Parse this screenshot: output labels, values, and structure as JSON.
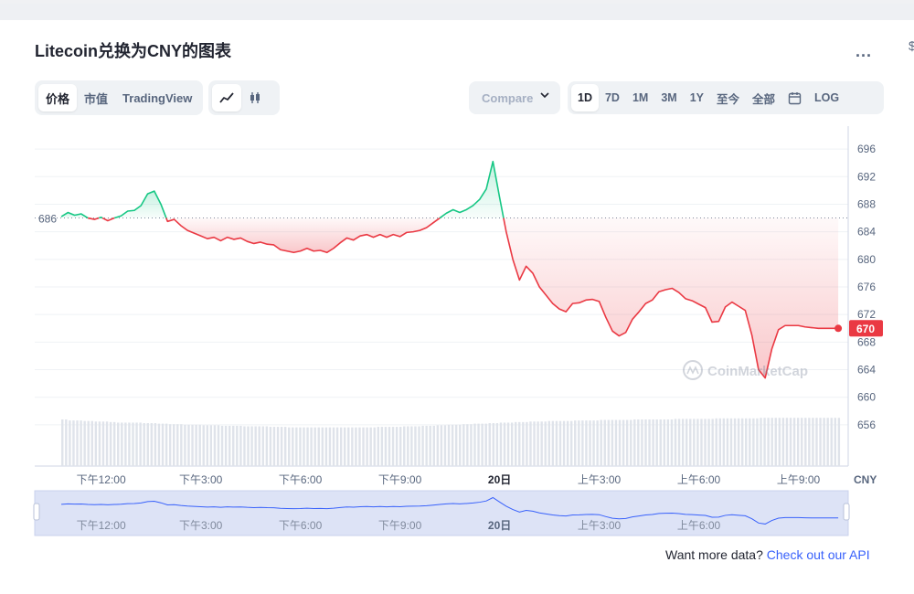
{
  "title": "Litecoin兑换为CNY的图表",
  "more_label": "...",
  "edge_mark": "$",
  "view_tabs": [
    "价格",
    "市值",
    "TradingView"
  ],
  "chart_type_icons": [
    "line-chart-icon",
    "candlestick-icon"
  ],
  "compare_label": "Compare  ",
  "range_tabs": [
    "1D",
    "7D",
    "1M",
    "3M",
    "1Y",
    "至今",
    "全部"
  ],
  "calendar_icon": "calendar-icon",
  "log_label": "LOG",
  "colors": {
    "up": "#16c784",
    "down": "#ea3943",
    "accent": "#3861fb"
  },
  "footer": {
    "text": "Want more data?",
    "link": "Check out our API"
  },
  "chart_data": {
    "type": "line",
    "currency": "CNY",
    "reference_price": 686,
    "reference_label": "686",
    "current_price": 670,
    "current_label": "670",
    "watermark": "CoinMarketCap",
    "y_ticks": [
      "696",
      "692",
      "688",
      "684",
      "680",
      "676",
      "672",
      "668",
      "664",
      "660",
      "656"
    ],
    "y_tick_values": [
      696,
      692,
      688,
      684,
      680,
      676,
      672,
      668,
      664,
      660,
      656
    ],
    "ylim": [
      654,
      698
    ],
    "x_ticks": [
      "下午12:00",
      "下午3:00",
      "下午6:00",
      "下午9:00",
      "20日",
      "上午3:00",
      "上午6:00",
      "上午9:00"
    ],
    "x_tick_hours": [
      12,
      15,
      18,
      21,
      24,
      27,
      30,
      33
    ],
    "navigator_ticks": [
      "下午12:00",
      "下午3:00",
      "下午6:00",
      "下午9:00",
      "20日",
      "上午3:00",
      "上午6:00"
    ],
    "xlim_hours": [
      10,
      34.5
    ],
    "series": [
      {
        "x": [
          10.8,
          11.0,
          11.2,
          11.4,
          11.6,
          11.8,
          12.0,
          12.2,
          12.4,
          12.6,
          12.8,
          13.0,
          13.2,
          13.4,
          13.6,
          13.8,
          14.0,
          14.2,
          14.4,
          14.6,
          14.8,
          15.0,
          15.2,
          15.4,
          15.6,
          15.8,
          16.0,
          16.2,
          16.4,
          16.6,
          16.8,
          17.0,
          17.2,
          17.4,
          17.6,
          17.8,
          18.0,
          18.2,
          18.4,
          18.6,
          18.8,
          19.0,
          19.2,
          19.4,
          19.6,
          19.8,
          20.0,
          20.2,
          20.4,
          20.6,
          20.8,
          21.0,
          21.2,
          21.4,
          21.6,
          21.8,
          22.0,
          22.2,
          22.4,
          22.6,
          22.8,
          23.0,
          23.2,
          23.4,
          23.6,
          23.8,
          24.0,
          24.2,
          24.4,
          24.6,
          24.8,
          25.0,
          25.2,
          25.4,
          25.6,
          25.8,
          26.0,
          26.2,
          26.4,
          26.6,
          26.8,
          27.0,
          27.2,
          27.4,
          27.6,
          27.8,
          28.0,
          28.2,
          28.4,
          28.6,
          28.8,
          29.0,
          29.2,
          29.4,
          29.6,
          29.8,
          30.0,
          30.2,
          30.4,
          30.6,
          30.8,
          31.0,
          31.2,
          31.4,
          31.6,
          31.8,
          32.0,
          32.2,
          32.4,
          32.6,
          32.8,
          33.0,
          33.2,
          33.4,
          33.6,
          33.8,
          34.0,
          34.1,
          34.2
        ],
        "y": [
          686.2,
          686.8,
          686.4,
          686.6,
          686.0,
          685.8,
          686.1,
          685.6,
          686.0,
          686.3,
          687.0,
          687.1,
          687.8,
          689.5,
          689.9,
          688.0,
          685.5,
          685.8,
          684.9,
          684.2,
          683.8,
          683.4,
          683.0,
          683.2,
          682.7,
          683.2,
          682.9,
          683.1,
          682.6,
          682.3,
          682.5,
          682.2,
          682.1,
          681.4,
          681.2,
          681.0,
          681.2,
          681.6,
          681.2,
          681.3,
          681.0,
          681.6,
          682.4,
          683.1,
          682.8,
          683.4,
          683.6,
          683.2,
          683.6,
          683.2,
          683.6,
          683.3,
          683.9,
          684.0,
          684.2,
          684.6,
          685.3,
          686.0,
          686.7,
          687.2,
          686.8,
          687.2,
          687.8,
          688.7,
          690.2,
          694.2,
          689.0,
          684.0,
          680.0,
          677.0,
          679.0,
          678.0,
          676.0,
          674.8,
          673.6,
          672.8,
          672.4,
          673.6,
          673.7,
          674.1,
          674.2,
          673.9,
          671.6,
          669.6,
          668.9,
          669.4,
          671.3,
          672.4,
          673.6,
          674.1,
          675.3,
          675.6,
          675.8,
          675.2,
          674.3,
          674.0,
          673.5,
          673.0,
          670.9,
          671.0,
          673.1,
          673.8,
          673.2,
          672.6,
          669.0,
          664.0,
          662.8,
          667.0,
          669.8,
          670.4,
          670.4,
          670.4,
          670.2,
          670.1,
          670.0,
          670.0,
          670.0,
          670.0,
          670.0
        ],
        "volume_level": [
          0.88,
          0.86,
          0.86,
          0.85,
          0.85,
          0.84,
          0.84,
          0.83,
          0.82,
          0.82,
          0.82,
          0.82,
          0.81,
          0.81,
          0.8,
          0.8,
          0.79,
          0.79,
          0.78,
          0.78,
          0.78,
          0.77,
          0.77,
          0.77,
          0.76,
          0.76,
          0.76,
          0.75,
          0.75,
          0.75,
          0.75,
          0.74,
          0.74,
          0.74,
          0.73,
          0.73,
          0.73,
          0.73,
          0.73,
          0.73,
          0.73,
          0.73,
          0.73,
          0.73,
          0.73,
          0.73,
          0.73,
          0.74,
          0.74,
          0.74,
          0.74,
          0.75,
          0.75,
          0.75,
          0.76,
          0.76,
          0.77,
          0.77,
          0.78,
          0.78,
          0.79,
          0.79,
          0.8,
          0.8,
          0.81,
          0.81,
          0.82,
          0.82,
          0.83,
          0.83,
          0.84,
          0.84,
          0.84,
          0.85,
          0.85,
          0.85,
          0.85,
          0.86,
          0.86,
          0.86,
          0.86,
          0.87,
          0.87,
          0.87,
          0.87,
          0.87,
          0.88,
          0.88,
          0.88,
          0.88,
          0.88,
          0.88,
          0.89,
          0.89,
          0.89,
          0.89,
          0.89,
          0.89,
          0.9,
          0.9,
          0.9,
          0.9,
          0.9,
          0.9,
          0.9,
          0.91,
          0.91,
          0.91,
          0.91,
          0.91,
          0.91,
          0.91,
          0.91,
          0.91,
          0.91,
          0.91,
          0.91,
          0.91,
          0.91
        ]
      }
    ]
  }
}
